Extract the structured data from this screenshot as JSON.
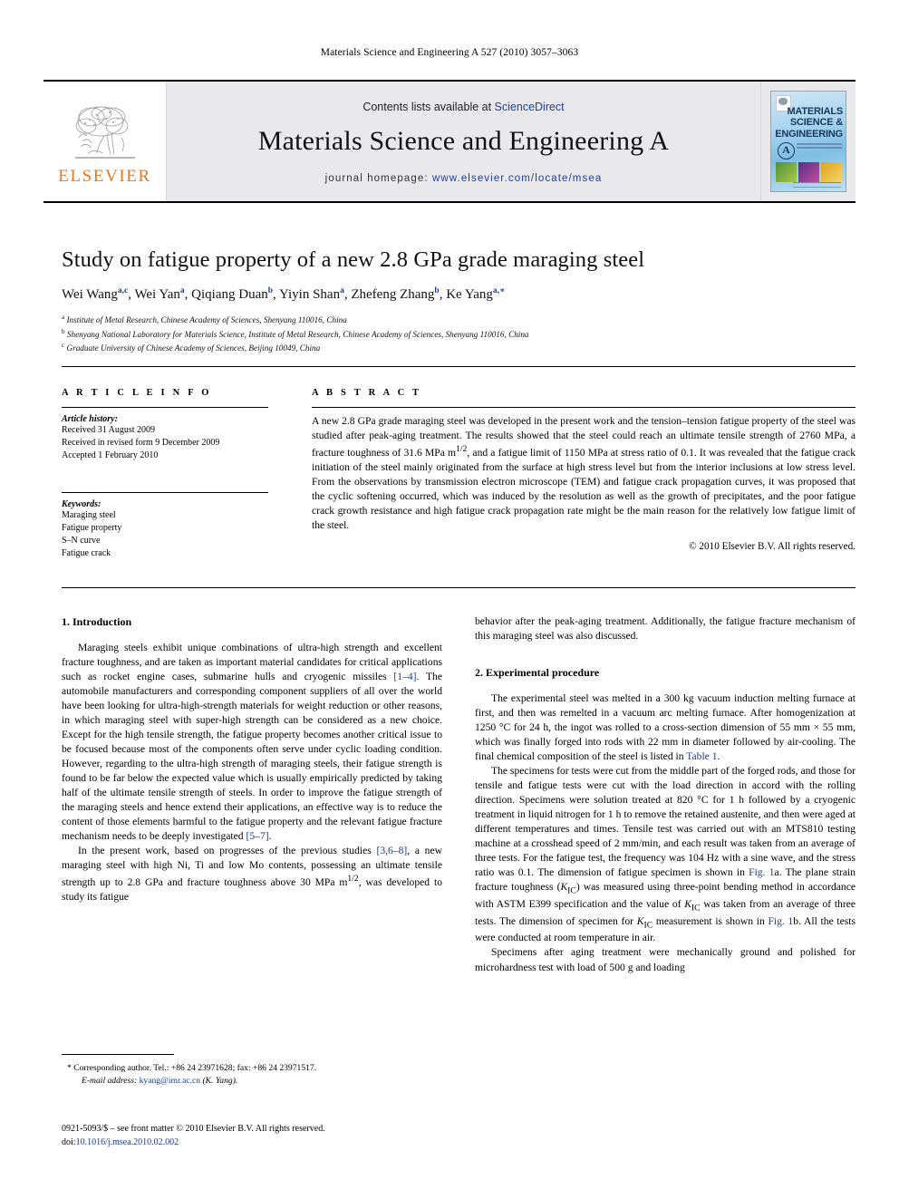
{
  "running_head": "Materials Science and Engineering A 527 (2010) 3057–3063",
  "masthead": {
    "contents_prefix": "Contents lists available at ",
    "sciencedirect": "ScienceDirect",
    "journal_title": "Materials Science and Engineering A",
    "homepage_label": "journal homepage:",
    "homepage_url": "www.elsevier.com/locate/msea",
    "publisher": "ELSEVIER",
    "cover": {
      "line1": "MATERIALS",
      "line2": "SCIENCE &",
      "line3": "ENGINEERING",
      "badge": "A"
    },
    "accent_orange": "#E87722",
    "link_blue": "#1e3fa0",
    "band_gray": "#e9e9ec"
  },
  "article": {
    "title": "Study on fatigue property of a new 2.8 GPa grade maraging steel",
    "authors_html": "Wei Wang<sup>a,c</sup>, Wei Yan<sup>a</sup>, Qiqiang Duan<sup>b</sup>, Yiyin Shan<sup>a</sup>, Zhefeng Zhang<sup>b</sup>, Ke Yang<sup>a,</sup><sup>∗</sup>",
    "affiliations": [
      "Institute of Metal Research, Chinese Academy of Sciences, Shenyang 110016, China",
      "Shenyang National Laboratory for Materials Science, Institute of Metal Research, Chinese Academy of Sciences, Shenyang 110016, China",
      "Graduate University of Chinese Academy of Sciences, Beijing 10049, China"
    ],
    "affiliation_marks": [
      "a",
      "b",
      "c"
    ]
  },
  "article_info": {
    "heading": "A R T I C L E    I N F O",
    "history_label": "Article history:",
    "history": [
      "Received 31 August 2009",
      "Received in revised form 9 December 2009",
      "Accepted 1 February 2010"
    ],
    "keywords_label": "Keywords:",
    "keywords": [
      "Maraging steel",
      "Fatigue property",
      "S–N curve",
      "Fatigue crack"
    ]
  },
  "abstract": {
    "heading": "A B S T R A C T",
    "text": "A new 2.8 GPa grade maraging steel was developed in the present work and the tension–tension fatigue property of the steel was studied after peak-aging treatment. The results showed that the steel could reach an ultimate tensile strength of 2760 MPa, a fracture toughness of 31.6 MPa m1/2, and a fatigue limit of 1150 MPa at stress ratio of 0.1. It was revealed that the fatigue crack initiation of the steel mainly originated from the surface at high stress level but from the interior inclusions at low stress level. From the observations by transmission electron microscope (TEM) and fatigue crack propagation curves, it was proposed that the cyclic softening occurred, which was induced by the resolution as well as the growth of precipitates, and the poor fatigue crack growth resistance and high fatigue crack propagation rate might be the main reason for the relatively low fatigue limit of the steel.",
    "copyright": "© 2010 Elsevier B.V. All rights reserved."
  },
  "sections": {
    "introduction_heading": "1.  Introduction",
    "introduction_p1_a": "Maraging steels exhibit unique combinations of ultra-high strength and excellent fracture toughness, and are taken as important material candidates for critical applications such as rocket engine cases, submarine hulls and cryogenic missiles ",
    "introduction_ref1": "[1–4]",
    "introduction_p1_b": ". The automobile manufacturers and corresponding component suppliers of all over the world have been looking for ultra-high-strength materials for weight reduction or other reasons, in which maraging steel with super-high strength can be considered as a new choice. Except for the high tensile strength, the fatigue property becomes another critical issue to be focused because most of the components often serve under cyclic loading condition. However, regarding to the ultra-high strength of maraging steels, their fatigue strength is found to be far below the expected value which is usually empirically predicted by taking half of the ultimate tensile strength of steels. In order to improve the fatigue strength of the maraging steels and hence extend their applications, an effective way is to reduce the content of those elements harmful to the fatigue property and the relevant fatigue fracture mechanism needs to be deeply investigated ",
    "introduction_ref2": "[5–7]",
    "introduction_p1_c": ".",
    "introduction_p2_a": "In the present work, based on progresses of the previous studies ",
    "introduction_ref3": "[3,6–8]",
    "introduction_p2_b": ", a new maraging steel with high Ni, Ti and low Mo contents, possessing an ultimate tensile strength up to 2.8 GPa and fracture toughness above 30 MPa m1/2, was developed to study its fatigue behavior after the peak-aging treatment. Additionally, the fatigue fracture mechanism of this maraging steel was also discussed.",
    "experimental_heading": "2.  Experimental procedure",
    "experimental_p1_a": "The experimental steel was melted in a 300 kg vacuum induction melting furnace at first, and then was remelted in a vacuum arc melting furnace. After homogenization at 1250 °C for 24 h, the ingot was rolled to a cross-section dimension of 55 mm × 55 mm, which was finally forged into rods with 22 mm in diameter followed by air-cooling. The final chemical composition of the steel is listed in ",
    "experimental_ref_table": "Table 1",
    "experimental_p1_b": ".",
    "experimental_p2_a": "The specimens for tests were cut from the middle part of the forged rods, and those for tensile and fatigue tests were cut with the load direction in accord with the rolling direction. Specimens were solution treated at 820 °C for 1 h followed by a cryogenic treatment in liquid nitrogen for 1 h to remove the retained austenite, and then were aged at different temperatures and times. Tensile test was carried out with an MTS810 testing machine at a crosshead speed of 2 mm/min, and each result was taken from an average of three tests. For the fatigue test, the frequency was 104 Hz with a sine wave, and the stress ratio was 0.1. The dimension of fatigue specimen is shown in ",
    "experimental_ref_fig1a": "Fig. 1",
    "experimental_p2_b": "a. The plane strain fracture toughness (KIC) was measured using three-point bending method in accordance with ASTM E399 specification and the value of KIC was taken from an average of three tests. The dimension of specimen for KIC measurement is shown in ",
    "experimental_ref_fig1b": "Fig. 1",
    "experimental_p2_c": "b. All the tests were conducted at room temperature in air.",
    "experimental_p3": "Specimens after aging treatment were mechanically ground and polished for microhardness test with load of 500 g and loading"
  },
  "footer": {
    "corresponding": "* Corresponding author. Tel.: +86 24 23971628; fax: +86 24 23971517.",
    "email_label": "E-mail address:",
    "email": "kyang@imr.ac.cn",
    "email_suffix": " (K. Yang).",
    "imprint": "0921-5093/$ – see front matter © 2010 Elsevier B.V. All rights reserved.",
    "doi_label": "doi:",
    "doi": "10.1016/j.msea.2010.02.002"
  }
}
